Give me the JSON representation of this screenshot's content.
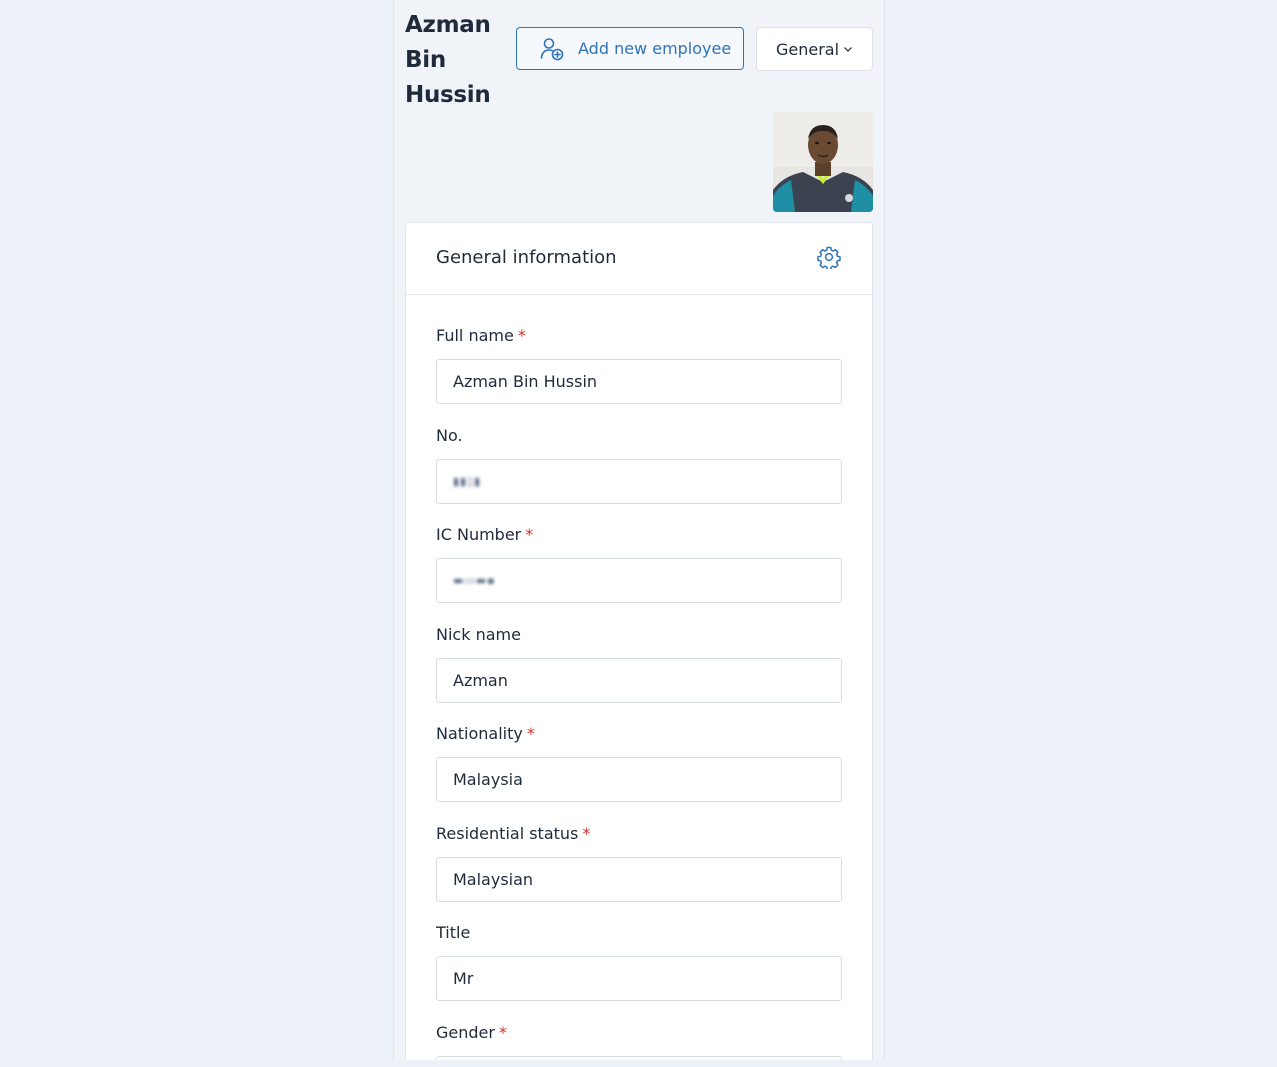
{
  "employee": {
    "name": "Azman Bin Hussin"
  },
  "header": {
    "add_button_label": "Add new employee",
    "section_dropdown_label": "General"
  },
  "card": {
    "title": "General information"
  },
  "fields": [
    {
      "label": "Full name",
      "required": true,
      "value": "Azman Bin Hussin"
    },
    {
      "label": "No.",
      "required": false,
      "value": "redacted"
    },
    {
      "label": "IC Number",
      "required": true,
      "value": "redacted"
    },
    {
      "label": "Nick name",
      "required": false,
      "value": "Azman"
    },
    {
      "label": "Nationality",
      "required": true,
      "value": "Malaysia"
    },
    {
      "label": "Residential status",
      "required": true,
      "value": "Malaysian"
    },
    {
      "label": "Title",
      "required": false,
      "value": "Mr"
    },
    {
      "label": "Gender",
      "required": true,
      "value": ""
    }
  ],
  "colors": {
    "accent": "#2f73b8",
    "required": "#d0342c",
    "page_bg": "#edf1f8"
  },
  "icons": {
    "add": "add-user-icon",
    "dropdown": "chevron-down-icon",
    "settings": "gear-icon"
  }
}
